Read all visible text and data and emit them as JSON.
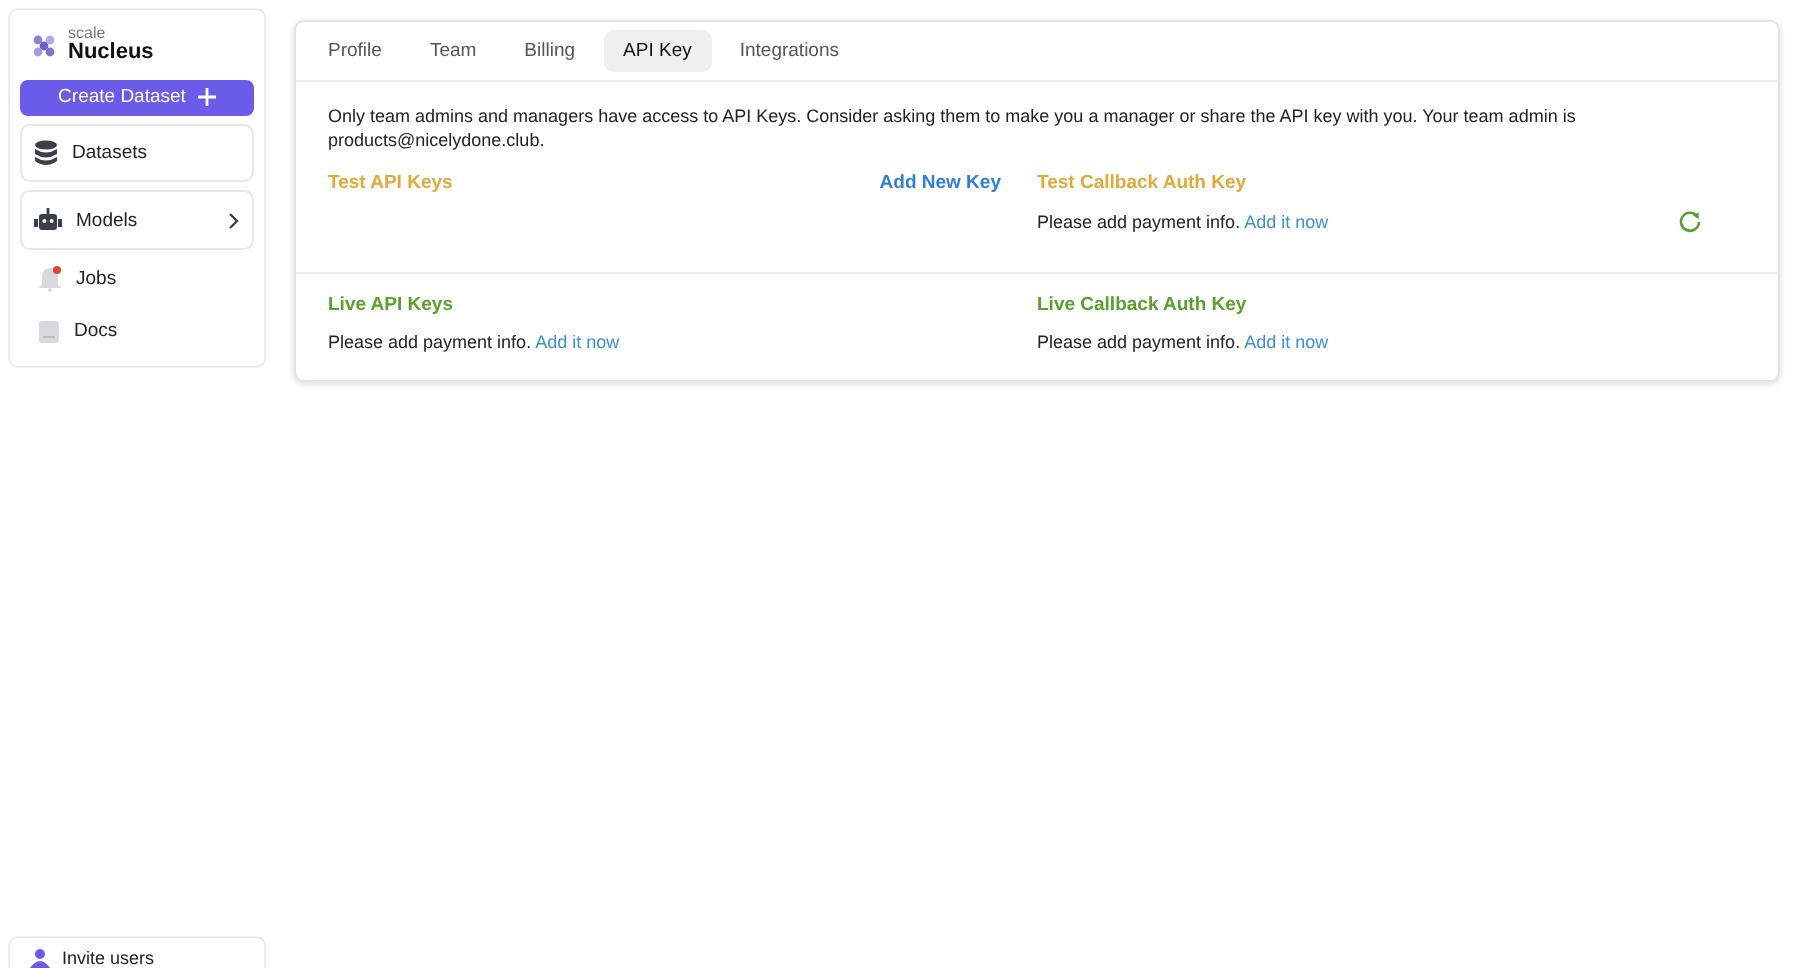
{
  "sidebar": {
    "brand_small": "scale",
    "brand": "Nucleus",
    "create_button": "Create Dataset",
    "items": [
      {
        "label": "Datasets",
        "kind": "card"
      },
      {
        "label": "Models",
        "kind": "card"
      },
      {
        "label": "Jobs",
        "kind": "plain"
      },
      {
        "label": "Docs",
        "kind": "plain"
      }
    ],
    "footer_item": "Invite users"
  },
  "tabs": [
    {
      "label": "Profile",
      "selected": false
    },
    {
      "label": "Team",
      "selected": false
    },
    {
      "label": "Billing",
      "selected": false
    },
    {
      "label": "API Key",
      "selected": true
    },
    {
      "label": "Integrations",
      "selected": false
    }
  ],
  "notice": "Only team admins and managers have access to API Keys. Consider asking them to make you a manager or share the API key with you. Your team admin is products@nicelydone.club.",
  "sections": [
    {
      "cells": [
        {
          "title": "Test API Keys",
          "color": "#e0a93a",
          "action": "Add New Key"
        },
        {
          "title": "Test Callback Auth Key",
          "color": "#e0a93a",
          "message": "Please add payment info.",
          "link": "Add it now"
        }
      ]
    },
    {
      "cells": [
        {
          "title": "Live API Keys",
          "color": "#5aa02c",
          "message": "Please add payment info.",
          "link": "Add it now"
        },
        {
          "title": "Live Callback Auth Key",
          "color": "#5aa02c",
          "message": "Please add payment info.",
          "link": "Add it now"
        }
      ]
    }
  ]
}
